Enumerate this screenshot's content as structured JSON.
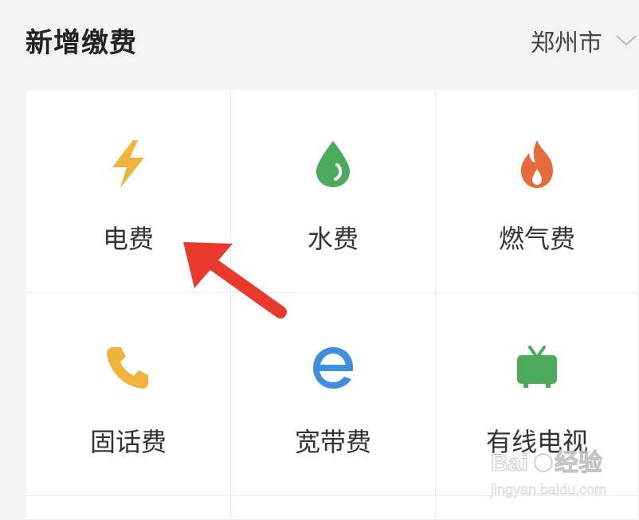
{
  "header": {
    "title": "新增缴费",
    "city": "郑州市"
  },
  "colors": {
    "electricity": "#f0b43c",
    "water": "#4caa5c",
    "gas": "#e56a3c",
    "landline": "#f0b43c",
    "broadband": "#3f8fdd",
    "tv": "#4caa5c",
    "arrow": "#e8392c"
  },
  "services": [
    {
      "label": "电费",
      "icon": "lightning-icon"
    },
    {
      "label": "水费",
      "icon": "water-drop-icon"
    },
    {
      "label": "燃气费",
      "icon": "flame-icon"
    },
    {
      "label": "固话费",
      "icon": "phone-icon"
    },
    {
      "label": "宽带费",
      "icon": "broadband-e-icon"
    },
    {
      "label": "有线电视",
      "icon": "tv-icon"
    }
  ],
  "watermark": {
    "brand": "Baidu经验",
    "url": "jingyan.baidu.com"
  }
}
